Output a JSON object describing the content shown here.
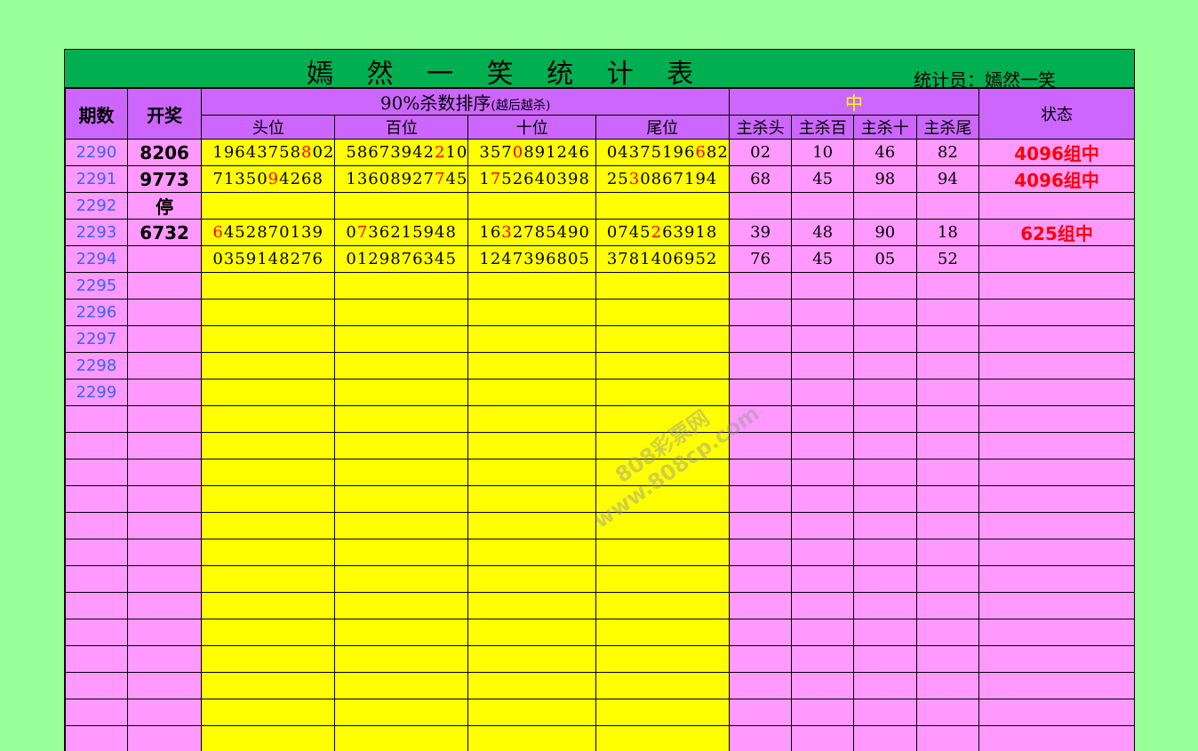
{
  "title": "嫣 然 一 笑 统 计 表",
  "statistician": "统计员：嫣然一笑",
  "headers": {
    "period": "期数",
    "draw": "开奖",
    "sort_main": "90%杀数排序",
    "sort_note": "(越后越杀)",
    "pos": [
      "头位",
      "百位",
      "十位",
      "尾位"
    ],
    "zhong": "中",
    "kill": [
      "主杀头",
      "主杀百",
      "主杀十",
      "主杀尾"
    ],
    "status": "状态"
  },
  "rows": [
    {
      "period": "2290",
      "draw": "8206",
      "pos": [
        [
          "19643758",
          "8",
          "02"
        ],
        [
          "58673942",
          "2",
          "10"
        ],
        [
          "357",
          "0",
          "891246"
        ],
        [
          "04375196",
          "6",
          "82"
        ]
      ],
      "kill": [
        "02",
        "10",
        "46",
        "82"
      ],
      "status": "4096组中"
    },
    {
      "period": "2291",
      "draw": "9773",
      "pos": [
        [
          "71350",
          "9",
          "4268"
        ],
        [
          "13608927",
          "7",
          "45"
        ],
        [
          "1",
          "7",
          "52640398"
        ],
        [
          "25",
          "3",
          "0867194"
        ]
      ],
      "kill": [
        "68",
        "45",
        "98",
        "94"
      ],
      "status": "4096组中"
    },
    {
      "period": "2292",
      "draw": "停",
      "pos": [
        [
          "",
          "",
          ""
        ],
        [
          "",
          "",
          ""
        ],
        [
          "",
          "",
          ""
        ],
        [
          "",
          "",
          ""
        ]
      ],
      "kill": [
        "",
        "",
        "",
        ""
      ],
      "status": ""
    },
    {
      "period": "2293",
      "draw": "6732",
      "pos": [
        [
          "",
          "6",
          "452870139"
        ],
        [
          "0",
          "7",
          "36215948"
        ],
        [
          "16",
          "3",
          "2785490"
        ],
        [
          "0745",
          "2",
          "63918"
        ]
      ],
      "kill": [
        "39",
        "48",
        "90",
        "18"
      ],
      "status": "625组中"
    },
    {
      "period": "2294",
      "draw": "",
      "pos": [
        [
          "0359148276",
          "",
          ""
        ],
        [
          "0129876345",
          "",
          ""
        ],
        [
          "1247396805",
          "",
          ""
        ],
        [
          "3781406952",
          "",
          ""
        ]
      ],
      "kill": [
        "76",
        "45",
        "05",
        "52"
      ],
      "status": ""
    },
    {
      "period": "2295",
      "draw": "",
      "pos": [
        [
          "",
          "",
          ""
        ],
        [
          "",
          "",
          ""
        ],
        [
          "",
          "",
          ""
        ],
        [
          "",
          "",
          ""
        ]
      ],
      "kill": [
        "",
        "",
        "",
        ""
      ],
      "status": ""
    },
    {
      "period": "2296",
      "draw": "",
      "pos": [
        [
          "",
          "",
          ""
        ],
        [
          "",
          "",
          ""
        ],
        [
          "",
          "",
          ""
        ],
        [
          "",
          "",
          ""
        ]
      ],
      "kill": [
        "",
        "",
        "",
        ""
      ],
      "status": ""
    },
    {
      "period": "2297",
      "draw": "",
      "pos": [
        [
          "",
          "",
          ""
        ],
        [
          "",
          "",
          ""
        ],
        [
          "",
          "",
          ""
        ],
        [
          "",
          "",
          ""
        ]
      ],
      "kill": [
        "",
        "",
        "",
        ""
      ],
      "status": ""
    },
    {
      "period": "2298",
      "draw": "",
      "pos": [
        [
          "",
          "",
          ""
        ],
        [
          "",
          "",
          ""
        ],
        [
          "",
          "",
          ""
        ],
        [
          "",
          "",
          ""
        ]
      ],
      "kill": [
        "",
        "",
        "",
        ""
      ],
      "status": ""
    },
    {
      "period": "2299",
      "draw": "",
      "pos": [
        [
          "",
          "",
          ""
        ],
        [
          "",
          "",
          ""
        ],
        [
          "",
          "",
          ""
        ],
        [
          "",
          "",
          ""
        ]
      ],
      "kill": [
        "",
        "",
        "",
        ""
      ],
      "status": ""
    }
  ],
  "empty_rows": 14,
  "watermark": [
    "808彩票网",
    "www.808cp.com"
  ]
}
